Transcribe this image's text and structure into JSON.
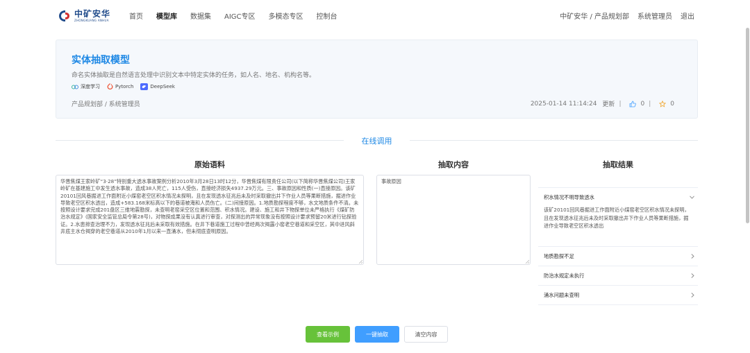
{
  "brand": {
    "name": "中矿安华",
    "sub": "ZHONGKUANG ANHUA"
  },
  "nav": {
    "links": [
      "首页",
      "模型库",
      "数据集",
      "AIGC专区",
      "多模态专区",
      "控制台"
    ],
    "active_index": 1,
    "breadcrumb": "中矿安华 / 产品规划部",
    "user": "系统管理员",
    "logout": "退出"
  },
  "model": {
    "title": "实体抽取模型",
    "description": "命名实体抽取是自然语言处理中识别文本中特定实体的任务，如人名、地名、机构名等。",
    "tags": [
      {
        "label": "深度学习",
        "icon": "deep-learning-icon"
      },
      {
        "label": "Pytorch",
        "icon": "pytorch-icon"
      },
      {
        "label": "DeepSeek",
        "icon": "deepseek-icon"
      }
    ],
    "owner": "产品规划部 / 系统管理员",
    "updated_time": "2025-01-14 11:14:24",
    "updated_label": "更新",
    "likes": "0",
    "stars": "0"
  },
  "section_label": "在线调用",
  "columns": {
    "source_title": "原始语料",
    "extract_title": "抽取内容",
    "result_title": "抽取结果"
  },
  "source_text": "华晋焦煤王家岭矿“3·28”特别重大透水事故案例分析2010年3月28日13时12分，华晋焦煤有限责任公司(以下简称华晋焦煤公司)王家岭矿在基建施工中发生透水事故，造成38人死亡，115人受伤，直接经济损失4937.29万元。三、事故原因和性质(一)直接原因。该矿20101回风巷掘进工作面附近小煤窑老空区积水情况未探明，且在发现透水征兆后未及时采取撤出井下作业人员等果断措施，掘进作业导致老空区积水透出，造成+583.168米标高以下的巷道被淹和人员伤亡。(二)间接原因。1.地质勘探程度不够，水文地质条件不清。未按照设计要求完成201盘区三维地震勘探，未查明老窑采空区位置和范围、积水情况。建设、施工和井下物探单位未严格执行《煤矿防治水规定》(国家安全监管总局令第28号)，对物探成果没有认真进行审查，对探测出的异常现象没有按照设计要求预留20米进行钻探验证。2.水患排查治理不力，发现透水征兆后未采取有效措施。在井下巷道施工过程中曾经两次揭露小窑老空巷道和采空区，其中进风斜井底主水仓揭穿的老空巷道从2010年1月以来一直涌水，但未彻底查明原因。",
  "extract_text": "事故原因",
  "results": [
    {
      "title": "积水情况不明导致透水",
      "expanded": true,
      "content": "该矿20101回风巷掘进工作面附近小煤窑老空区积水情况未探明，且在发现透水征兆后未及时采取撤出井下作业人员等果断措施，掘进作业导致老空区积水透出"
    },
    {
      "title": "地质勘探不足",
      "expanded": false
    },
    {
      "title": "防治水规定未执行",
      "expanded": false
    },
    {
      "title": "涌水问题未查明",
      "expanded": false
    }
  ],
  "buttons": {
    "example": "查看示例",
    "extract": "一键抽取",
    "clear": "清空内容"
  },
  "colors": {
    "primary": "#1e88e5",
    "green": "#67c23a",
    "blue": "#409eff",
    "like": "#409eff",
    "star": "#f0a020"
  }
}
